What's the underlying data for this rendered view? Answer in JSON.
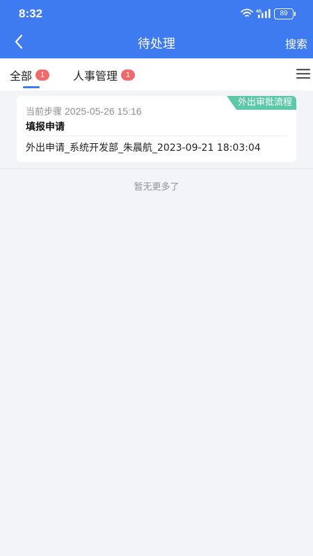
{
  "status_bar": {
    "time": "8:32",
    "battery": "89"
  },
  "nav": {
    "title": "待处理",
    "search_label": "搜索"
  },
  "tabs": [
    {
      "label": "全部",
      "badge": "1"
    },
    {
      "label": "人事管理",
      "badge": "1"
    }
  ],
  "list": {
    "items": [
      {
        "tag": "外出审批流程",
        "step_label": "当前步骤",
        "step_time": "2025-05-26 15:16",
        "title": "填报申请",
        "description": "外出申请_系统开发部_朱晨航_2023-09-21 18:03:04"
      }
    ],
    "end_text": "暂无更多了"
  },
  "colors": {
    "primary": "#3f7bf0",
    "badge": "#ef6a6a",
    "tag": "#5dc9a8",
    "background": "#f2f4f7"
  },
  "icons": {
    "back": "chevron-left-icon",
    "menu": "hamburger-menu-icon",
    "wifi": "wifi-icon",
    "signal": "signal-icon",
    "battery": "battery-icon"
  }
}
